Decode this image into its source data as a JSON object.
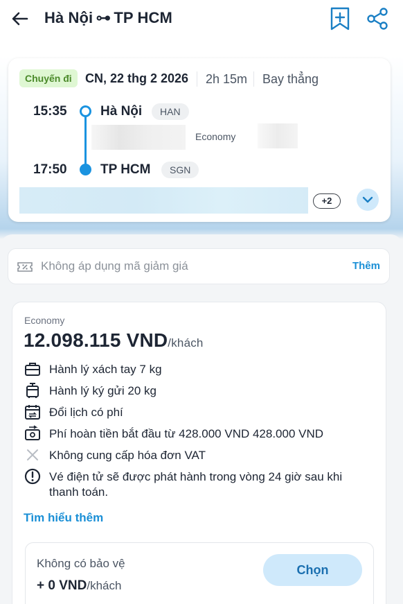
{
  "header": {
    "origin": "Hà Nội",
    "arrow": "⊶",
    "destination": "TP HCM",
    "icons": [
      "back-arrow-icon",
      "bookmark-add-icon",
      "share-icon"
    ]
  },
  "flight": {
    "badge": "Chuyến đi",
    "date": "CN, 22 thg 2 2026",
    "duration": "2h 15m",
    "type": "Bay thẳng",
    "departure": {
      "time": "15:35",
      "city": "Hà Nội",
      "code": "HAN"
    },
    "arrival": {
      "time": "17:50",
      "city": "TP HCM",
      "code": "SGN"
    },
    "cabin": "Economy",
    "more_count": "+2"
  },
  "promo": {
    "text": "Không áp dụng mã giảm giá",
    "action": "Thêm"
  },
  "fare": {
    "class": "Economy",
    "price": "12.098.115 VND",
    "per": "/khách",
    "features": [
      {
        "icon": "briefcase-icon",
        "text": "Hành lý xách tay 7 kg"
      },
      {
        "icon": "luggage-icon",
        "text": "Hành lý ký gửi 20 kg"
      },
      {
        "icon": "calendar-change-icon",
        "text": "Đổi lịch có phí"
      },
      {
        "icon": "refund-icon",
        "text": "Phí hoàn tiền bắt đầu từ 428.000 VND 428.000 VND"
      },
      {
        "icon": "close-icon",
        "text": "Không cung cấp hóa đơn VAT"
      },
      {
        "icon": "info-icon",
        "text": "Vé điện tử sẽ được phát hành trong vòng 24 giờ sau khi thanh toán."
      }
    ],
    "learn_more": "Tìm hiểu thêm"
  },
  "protection": {
    "title": "Không có bảo vệ",
    "price": "+ 0 VND",
    "per": "/khách",
    "button": "Chọn"
  },
  "colors": {
    "accent": "#1a93e0",
    "link": "#1a8fd6",
    "badge_bg": "#dff7d3",
    "badge_text": "#4b8a2a",
    "button_bg": "#cfe9fb"
  }
}
